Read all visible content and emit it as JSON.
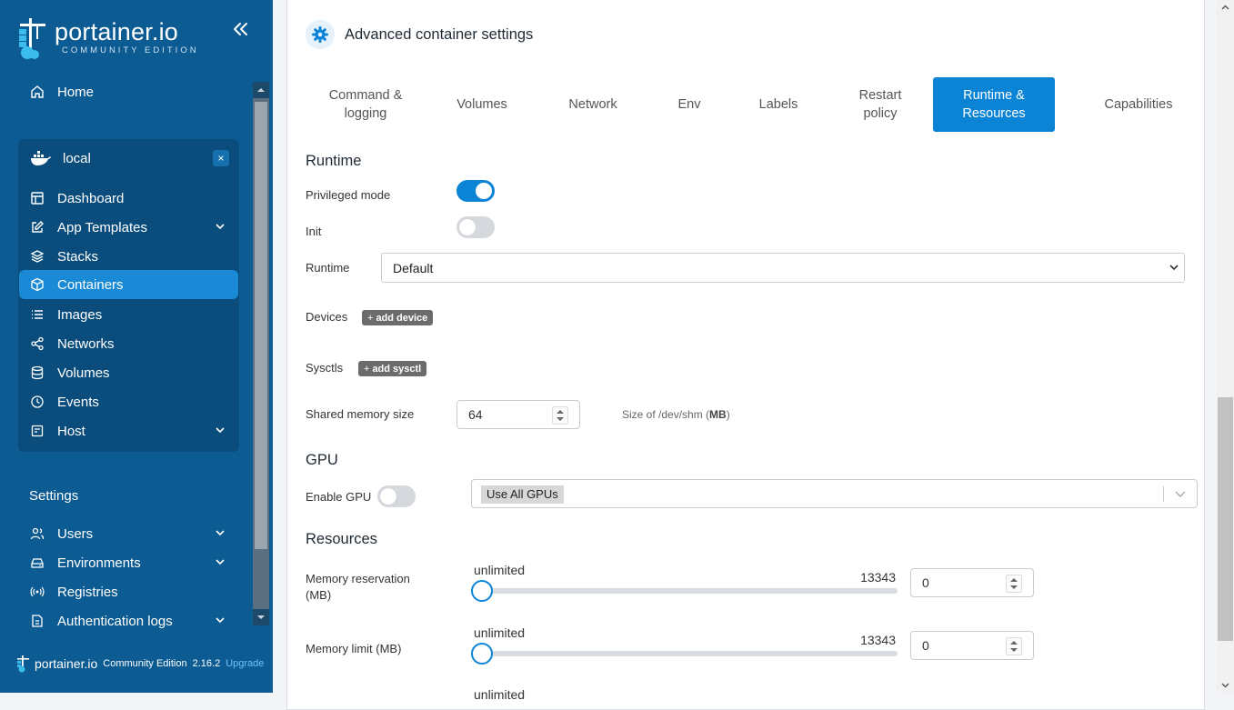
{
  "brand": {
    "name": "portainer.io",
    "subtitle": "COMMUNITY EDITION"
  },
  "sidebar": {
    "home": "Home",
    "environment": {
      "name": "local",
      "close": "×",
      "items": [
        {
          "label": "Dashboard",
          "icon": "dashboard-icon"
        },
        {
          "label": "App Templates",
          "icon": "edit-icon",
          "expandable": true
        },
        {
          "label": "Stacks",
          "icon": "layers-icon"
        },
        {
          "label": "Containers",
          "icon": "box-icon",
          "active": true
        },
        {
          "label": "Images",
          "icon": "list-icon"
        },
        {
          "label": "Networks",
          "icon": "share-icon"
        },
        {
          "label": "Volumes",
          "icon": "database-icon"
        },
        {
          "label": "Events",
          "icon": "clock-icon"
        },
        {
          "label": "Host",
          "icon": "server-icon",
          "expandable": true
        }
      ]
    },
    "settings": {
      "heading": "Settings",
      "items": [
        {
          "label": "Users",
          "icon": "users-icon",
          "expandable": true
        },
        {
          "label": "Environments",
          "icon": "hdd-icon",
          "expandable": true
        },
        {
          "label": "Registries",
          "icon": "radio-icon"
        },
        {
          "label": "Authentication logs",
          "icon": "file-icon",
          "expandable": true
        }
      ]
    },
    "footer": {
      "brand": "portainer.io",
      "edition": "Community Edition",
      "version": "2.16.2",
      "upgrade": "Upgrade"
    }
  },
  "card": {
    "title": "Advanced container settings",
    "tabs": [
      {
        "line1": "Command &",
        "line2": "logging"
      },
      {
        "line1": "Volumes",
        "line2": ""
      },
      {
        "line1": "Network",
        "line2": ""
      },
      {
        "line1": "Env",
        "line2": ""
      },
      {
        "line1": "Labels",
        "line2": ""
      },
      {
        "line1": "Restart",
        "line2": "policy"
      },
      {
        "line1": "Runtime &",
        "line2": "Resources",
        "active": true
      },
      {
        "line1": "Capabilities",
        "line2": ""
      }
    ]
  },
  "runtime": {
    "heading": "Runtime",
    "privileged_label": "Privileged mode",
    "privileged_on": true,
    "init_label": "Init",
    "init_on": false,
    "runtime_label": "Runtime",
    "runtime_value": "Default",
    "devices_label": "Devices",
    "add_device": "add device",
    "sysctls_label": "Sysctls",
    "add_sysctl": "add sysctl",
    "shm_label": "Shared memory size",
    "shm_value": "64",
    "shm_help_prefix": "Size of /dev/shm (",
    "shm_help_unit": "MB",
    "shm_help_suffix": ")"
  },
  "gpu": {
    "heading": "GPU",
    "enable_label": "Enable GPU",
    "enable_on": false,
    "selected": "Use All GPUs"
  },
  "resources": {
    "heading": "Resources",
    "memory_reservation": {
      "label_line1": "Memory reservation",
      "label_line2": "(MB)",
      "min_label": "unlimited",
      "max_label": "13343",
      "value": "0",
      "slider_value": 0
    },
    "memory_limit": {
      "label": "Memory limit (MB)",
      "min_label": "unlimited",
      "max_label": "13343",
      "value": "0",
      "slider_value": 0
    },
    "next_partial": "unlimited"
  },
  "colors": {
    "sidebar": "#0c5b92",
    "accent": "#0b84d6",
    "active_nav": "#1a8ad6"
  }
}
